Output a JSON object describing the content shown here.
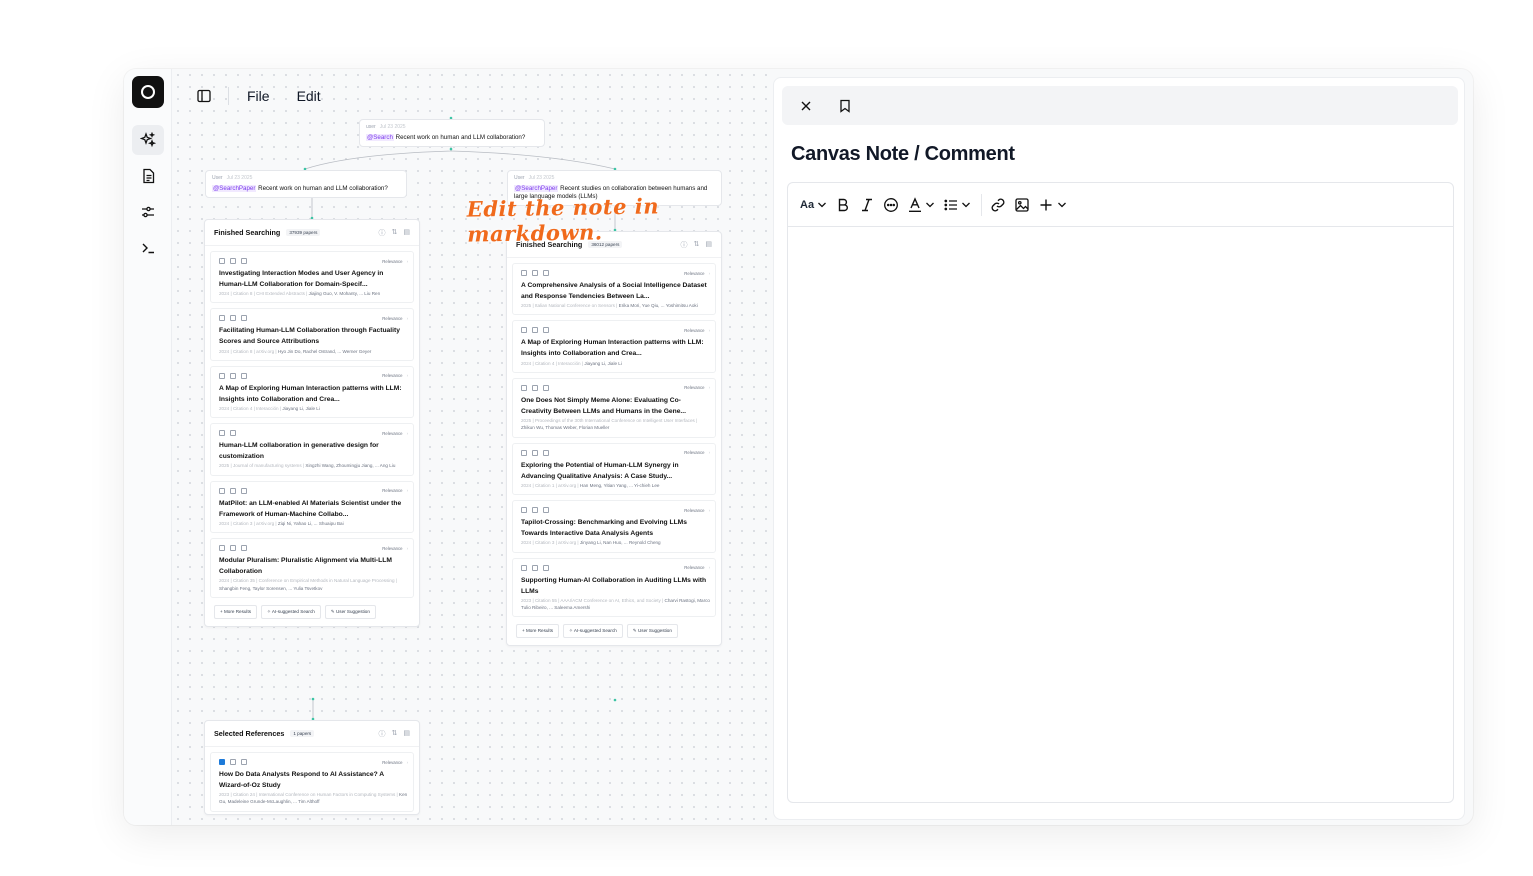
{
  "menu": {
    "file": "File",
    "edit": "Edit"
  },
  "canvas": {
    "root_bubble": {
      "who": "user",
      "time": "Jul 23 2025",
      "tag": "@Search",
      "text": "Recent work on human and LLM collaboration?"
    },
    "left_bubble": {
      "who": "User",
      "time": "Jul 23 2025",
      "tag": "@SearchPaper",
      "text": "Recent work on human and LLM collaboration?"
    },
    "right_bubble": {
      "who": "User",
      "time": "Jul 23 2025",
      "tag": "@SearchPaper",
      "text": "Recent studies on collaboration between humans and large language models (LLMs)"
    },
    "annotation": "Edit the note in markdown.",
    "left_card": {
      "title": "Finished Searching",
      "count": "37939 papers",
      "papers": [
        {
          "title": "Investigating Interaction Modes and User Agency in Human-LLM Collaboration for Domain-Specif...",
          "meta": "2024 | Citation 8 | CHI Extended Abstracts |",
          "authors": "Jiajing Guo, V. Mohanty, ... Liu Ren",
          "icons": 3
        },
        {
          "title": "Facilitating Human-LLM Collaboration through Factuality Scores and Source Attributions",
          "meta": "2024 | Citation 8 | arXiv.org |",
          "authors": "Hyo Jin Do, Rachel Ostrand, ... Werner Geyer",
          "icons": 3
        },
        {
          "title": "A Map of Exploring Human Interaction patterns with LLM: Insights into Collaboration and Crea...",
          "meta": "2024 | Citation 4 | Interacción |",
          "authors": "Jiayang Li, Jiale Li",
          "icons": 3
        },
        {
          "title": "Human-LLM collaboration in generative design for customization",
          "meta": "2025 | Journal of manufacturing systems |",
          "authors": "Xingzhi Wang, Zhoumingju Jiang, ... Ang Liu",
          "icons": 2
        },
        {
          "title": "MatPilot: an LLM-enabled AI Materials Scientist under the Framework of Human-Machine Collabo...",
          "meta": "2024 | Citation 3 | arXiv.org |",
          "authors": "Ziqi Ni, Yahao Li, ... Shuaipu Bai",
          "icons": 3
        },
        {
          "title": "Modular Pluralism: Pluralistic Alignment via Multi-LLM Collaboration",
          "meta": "2024 | Citation 35 | Conference on Empirical Methods in Natural Language Processing |",
          "authors": "Shangbin Feng, Taylor Sorensen, ... Yulia Tsvetkov",
          "icons": 3
        }
      ]
    },
    "right_card": {
      "title": "Finished Searching",
      "count": "36012 papers",
      "papers": [
        {
          "title": "A Comprehensive Analysis of a Social Intelligence Dataset and Response Tendencies Between La...",
          "meta": "2025 | Italian National Conference on Sensors |",
          "authors": "Erika Mori, Yue Qiu, ... Yoshimitsu Aoki",
          "icons": 3
        },
        {
          "title": "A Map of Exploring Human Interaction patterns with LLM: Insights into Collaboration and Crea...",
          "meta": "2024 | Citation 4 | Interacción |",
          "authors": "Jiayang Li, Jiale Li",
          "icons": 3
        },
        {
          "title": "One Does Not Simply Meme Alone: Evaluating Co-Creativity Between LLMs and Humans in the Gene...",
          "meta": "2025 | Proceedings of the 30th International Conference on Intelligent User Interfaces |",
          "authors": "Zhikun Wu, Thomas Weber, Florian Mueller",
          "icons": 3
        },
        {
          "title": "Exploring the Potential of Human-LLM Synergy in Advancing Qualitative Analysis: A Case Study...",
          "meta": "2024 | Citation 1 | arXiv.org |",
          "authors": "Han Meng, Yitian Yang, ... Yi-chieh Lee",
          "icons": 3
        },
        {
          "title": "Tapilot-Crossing: Benchmarking and Evolving LLMs Towards Interactive Data Analysis Agents",
          "meta": "2024 | Citation 3 | arXiv.org |",
          "authors": "Jinyang Li, Nan Huo, ... Reynold Cheng",
          "icons": 3
        },
        {
          "title": "Supporting Human-AI Collaboration in Auditing LLMs with LLMs",
          "meta": "2023 | Citation 55 | AAAI/ACM Conference on AI, Ethics, and Society |",
          "authors": "Charvi Rastogi, Marco Tulio Ribeiro, ... Saleema Amershi",
          "icons": 3
        }
      ]
    },
    "selected_card": {
      "title": "Selected References",
      "count": "1 papers",
      "papers": [
        {
          "title": "How Do Data Analysts Respond to AI Assistance? A Wizard-of-Oz Study",
          "meta": "2023 | Citation 24 | International Conference on Human Factors in Computing Systems |",
          "authors": "Ken Gu, Madeleine Grunde-McLaughlin, ... Tim Althoff",
          "icons": 3
        }
      ]
    },
    "relevance": "Relevance",
    "footer": {
      "more": "More Results",
      "ai": "AI-suggested Search",
      "user": "User Suggestion"
    }
  },
  "panel": {
    "title": "Canvas Note / Comment",
    "toolbar": {
      "font_size": "Aa"
    }
  }
}
